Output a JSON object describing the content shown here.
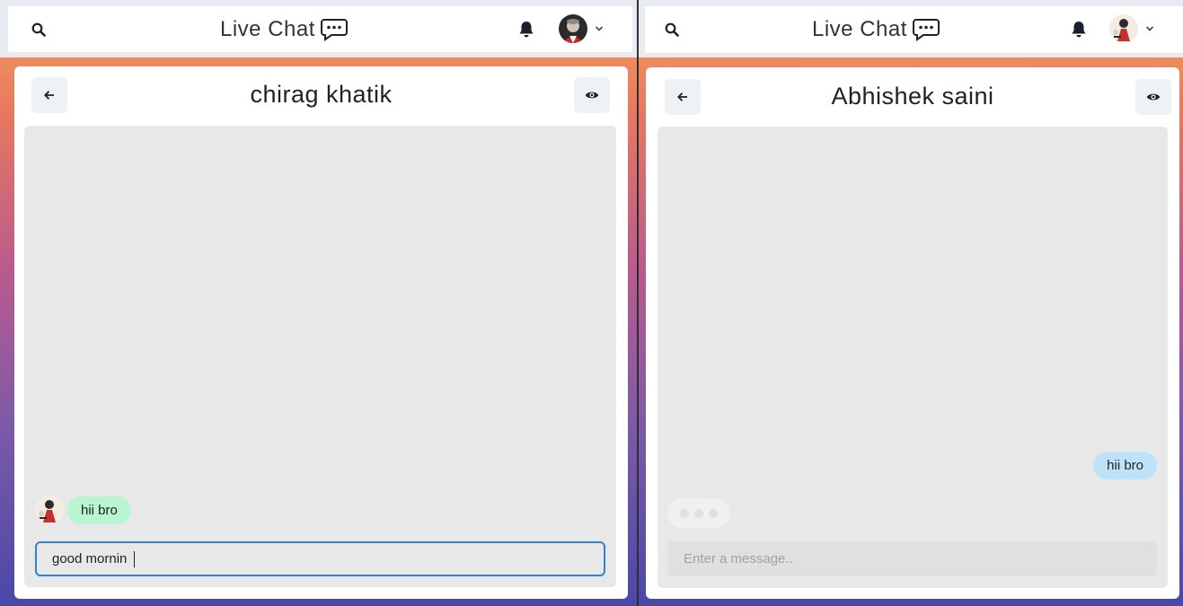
{
  "app": {
    "title": "Live Chat"
  },
  "left_window": {
    "chat": {
      "contact_name": "chirag khatik",
      "messages": [
        {
          "text": "hii bro",
          "direction": "received"
        }
      ],
      "input": {
        "value": "good mornin",
        "placeholder": "Enter a message.."
      }
    }
  },
  "right_window": {
    "chat": {
      "contact_name": "Abhishek saini",
      "messages": [
        {
          "text": "hii bro",
          "direction": "sent"
        }
      ],
      "typing_indicator": true,
      "input": {
        "value": "",
        "placeholder": "Enter a message.."
      }
    }
  },
  "colors": {
    "accent": "#3182ce",
    "received_bubble": "#b9f5d0",
    "sent_bubble": "#bee3f8",
    "chat_background": "#e8e8e8"
  },
  "icons": {
    "search": "search-icon",
    "chat": "chat-bubble-icon",
    "bell": "bell-icon",
    "chevron": "chevron-down-icon",
    "back": "arrow-left-icon",
    "view": "eye-icon"
  }
}
